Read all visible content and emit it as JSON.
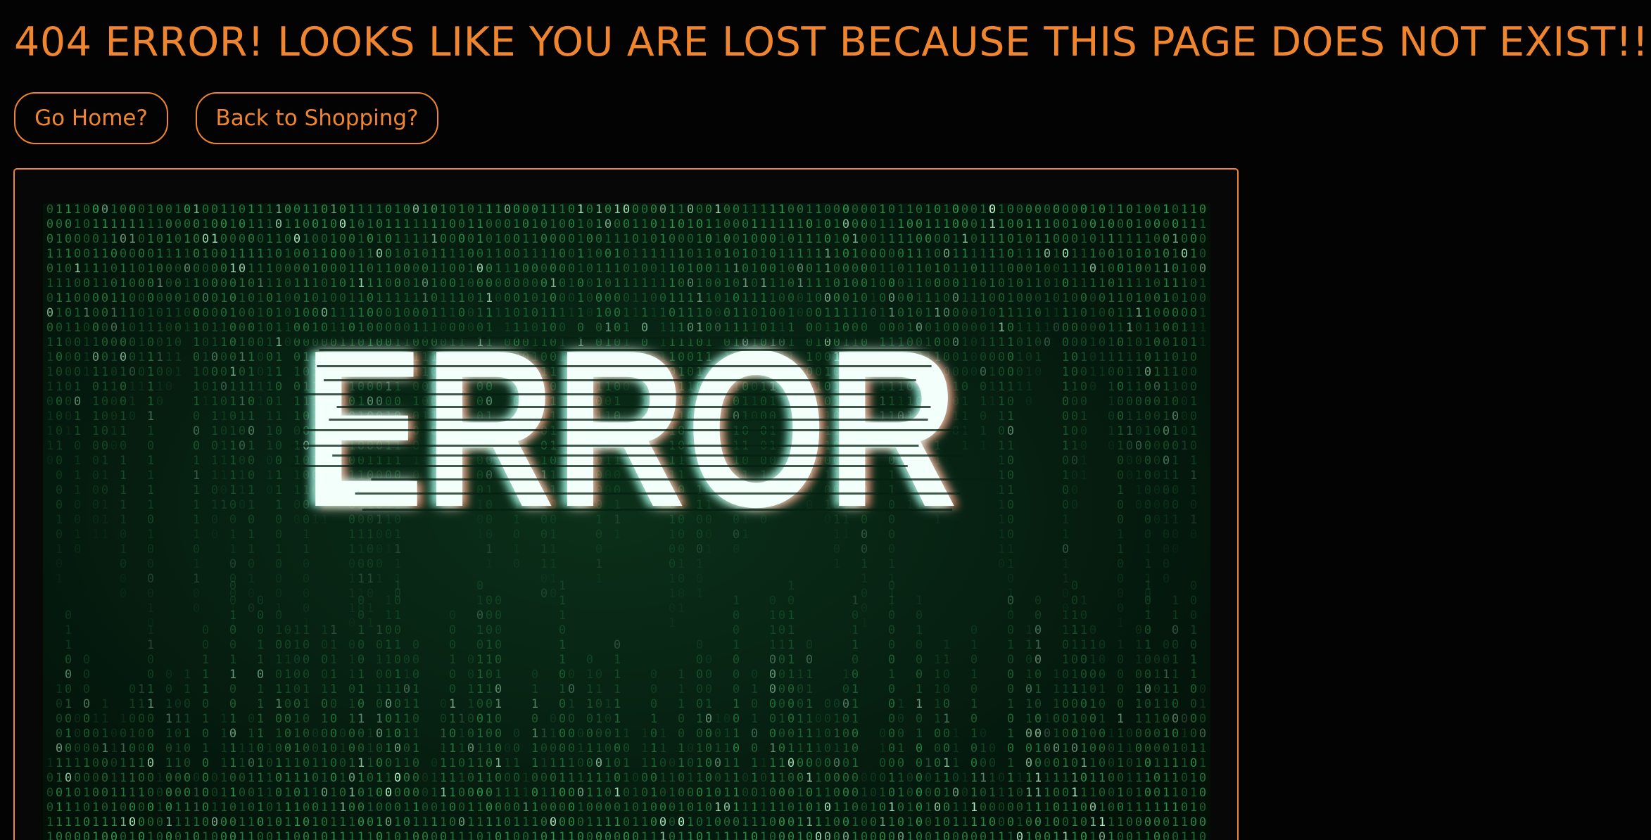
{
  "page": {
    "title": "404 ERROR! LOOKS LIKE YOU ARE LOST BECAUSE THIS PAGE DOES NOT EXIST!!!"
  },
  "actions": {
    "home_label": "Go Home?",
    "shopping_label": "Back to Shopping?"
  },
  "error_image": {
    "word": "ERROR",
    "background_characters": [
      "0",
      "1"
    ]
  },
  "colors": {
    "background": "#030303",
    "accent": "#f0852f",
    "matrix_green": "#2f9a4e",
    "glitch_cyan": "#8dffe6",
    "glitch_red": "#ff6a3a"
  }
}
